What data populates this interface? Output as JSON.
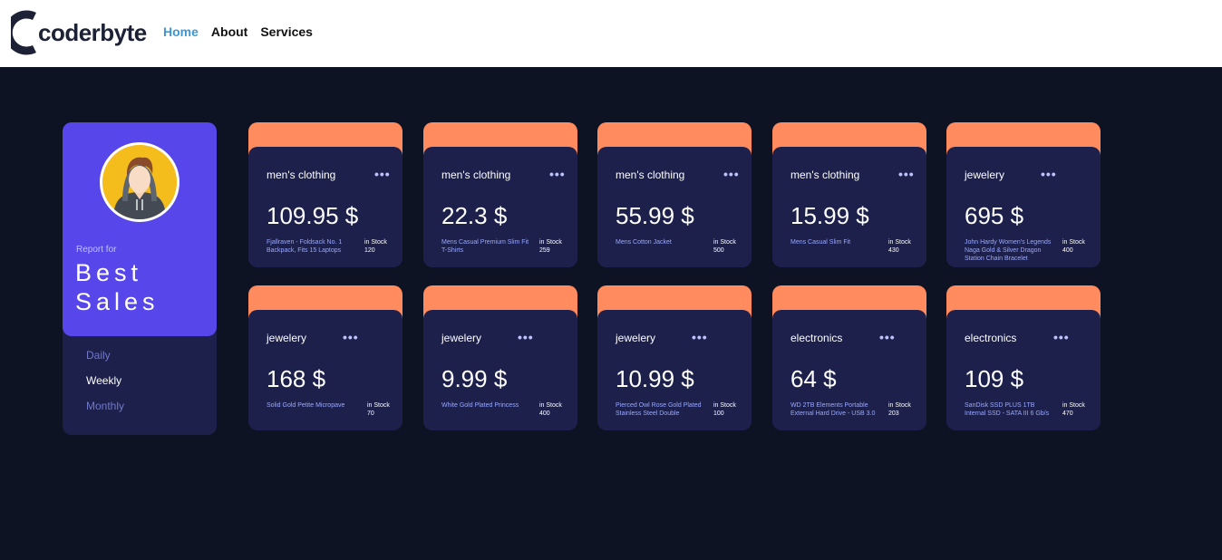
{
  "brand": {
    "logo_text": "coderbyte"
  },
  "nav": {
    "home": "Home",
    "about": "About",
    "services": "Services"
  },
  "profile": {
    "report_label": "Report for",
    "title": "Best Sales",
    "periods": {
      "daily": "Daily",
      "weekly": "Weekly",
      "monthly": "Monthly"
    },
    "active_period": "Weekly"
  },
  "colors": {
    "accent": "#5747ea",
    "card_top": "#ff8b5f",
    "card_body": "#1c204b",
    "background": "#0d1323",
    "nav_active": "#3e97d2"
  },
  "cards": [
    {
      "category": "men's clothing",
      "price": "109.95 $",
      "name": "Fjallraven - Foldsack No. 1 Backpack, Fits 15 Laptops",
      "stock_label": "in Stock",
      "stock": "120"
    },
    {
      "category": "men's clothing",
      "price": "22.3 $",
      "name": "Mens Casual Premium Slim Fit T-Shirts",
      "stock_label": "in Stock",
      "stock": "259"
    },
    {
      "category": "men's clothing",
      "price": "55.99 $",
      "name": "Mens Cotton Jacket",
      "stock_label": "in Stock",
      "stock": "500"
    },
    {
      "category": "men's clothing",
      "price": "15.99 $",
      "name": "Mens Casual Slim Fit",
      "stock_label": "in Stock",
      "stock": "430"
    },
    {
      "category": "jewelery",
      "price": "695 $",
      "name": "John Hardy Women's Legends Naga Gold & Silver Dragon Station Chain Bracelet",
      "stock_label": "in Stock",
      "stock": "400"
    },
    {
      "category": "jewelery",
      "price": "168 $",
      "name": "Solid Gold Petite Micropave",
      "stock_label": "in Stock",
      "stock": "70"
    },
    {
      "category": "jewelery",
      "price": "9.99 $",
      "name": "White Gold Plated Princess",
      "stock_label": "in Stock",
      "stock": "400"
    },
    {
      "category": "jewelery",
      "price": "10.99 $",
      "name": "Pierced Owl Rose Gold Plated Stainless Steel Double",
      "stock_label": "in Stock",
      "stock": "100"
    },
    {
      "category": "electronics",
      "price": "64 $",
      "name": "WD 2TB Elements Portable External Hard Drive - USB 3.0",
      "stock_label": "in Stock",
      "stock": "203"
    },
    {
      "category": "electronics",
      "price": "109 $",
      "name": "SanDisk SSD PLUS 1TB Internal SSD - SATA III 6 Gb/s",
      "stock_label": "in Stock",
      "stock": "470"
    }
  ],
  "icons": {
    "logo": "coderbyte-logo-icon",
    "avatar": "user-avatar-icon",
    "menu": "more-dots-icon"
  }
}
